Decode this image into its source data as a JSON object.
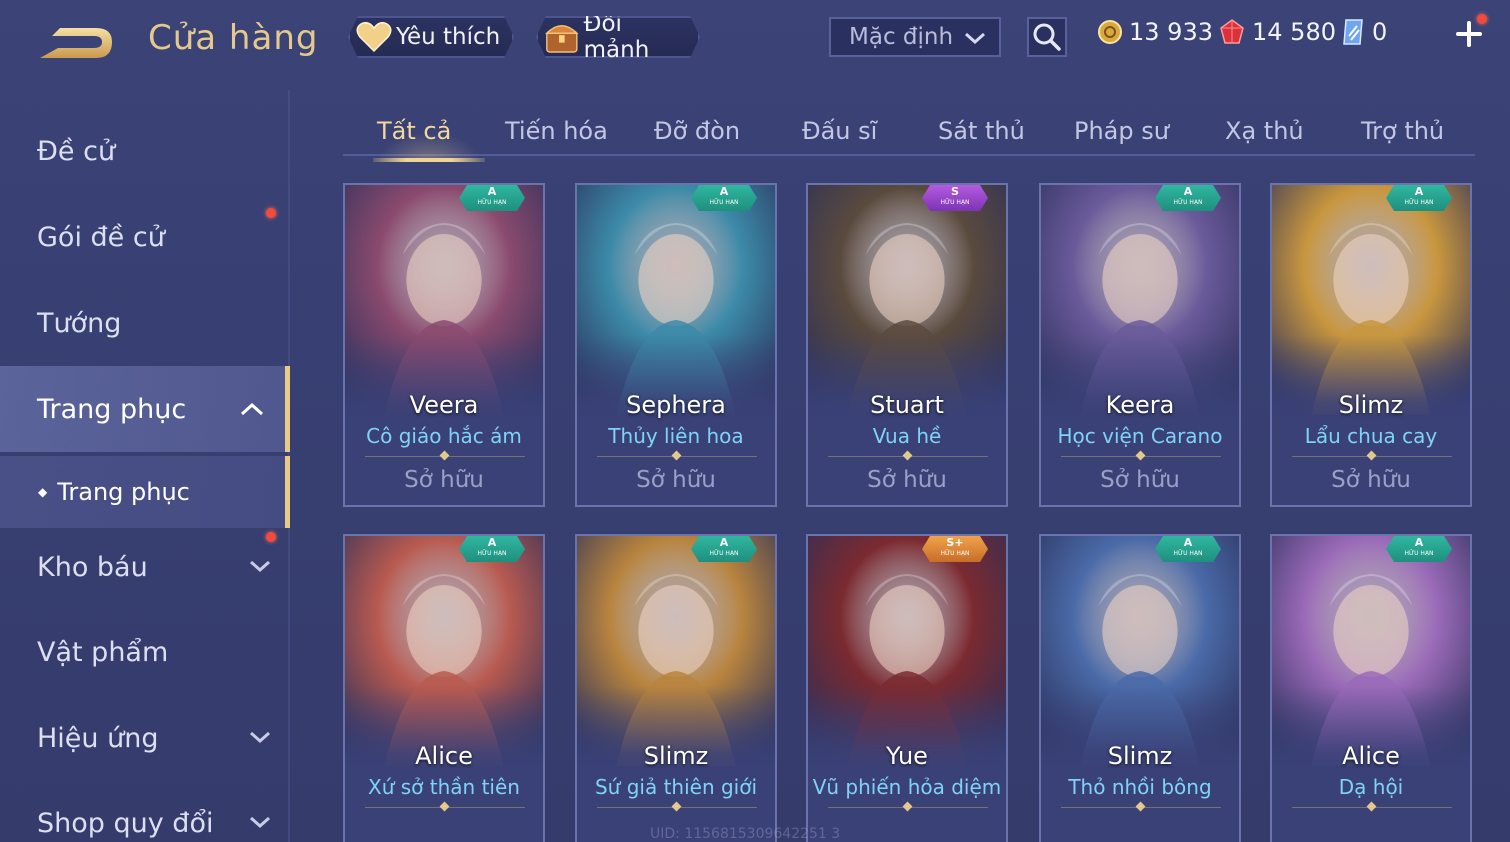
{
  "header": {
    "title": "Cửa hàng",
    "favorite_label": "Yêu thích",
    "exchange_label": "Đổi mảnh",
    "sort_value": "Mặc định"
  },
  "currencies": {
    "gold": "13 933",
    "vouchers": "14 580",
    "diamonds": "0"
  },
  "sidebar": {
    "items": [
      {
        "label": "Đề cử"
      },
      {
        "label": "Gói đề cử"
      },
      {
        "label": "Tướng"
      },
      {
        "label": "Trang phục"
      },
      {
        "label": "Trang phục"
      },
      {
        "label": "Kho báu"
      },
      {
        "label": "Vật phẩm"
      },
      {
        "label": "Hiệu ứng"
      },
      {
        "label": "Shop quy đổi"
      }
    ]
  },
  "tabs": [
    {
      "label": "Tất cả"
    },
    {
      "label": "Tiến hóa"
    },
    {
      "label": "Đỡ đòn"
    },
    {
      "label": "Đấu sĩ"
    },
    {
      "label": "Sát thủ"
    },
    {
      "label": "Pháp sư"
    },
    {
      "label": "Xạ thủ"
    },
    {
      "label": "Trợ thủ"
    }
  ],
  "cards": [
    {
      "hero": "Veera",
      "skin": "Cô giáo hắc ám",
      "status": "Sở hữu",
      "rank": "A",
      "tag": "HỮU HẠN",
      "color": "#8a4a6e"
    },
    {
      "hero": "Sephera",
      "skin": "Thủy liên hoa",
      "status": "Sở hữu",
      "rank": "A",
      "tag": "HỮU HẠN",
      "color": "#3c8aa8"
    },
    {
      "hero": "Stuart",
      "skin": "Vua hề",
      "status": "Sở hữu",
      "rank": "S",
      "tag": "HỮU HẠN",
      "color": "#5a4a3e"
    },
    {
      "hero": "Keera",
      "skin": "Học viện Carano",
      "status": "Sở hữu",
      "rank": "A",
      "tag": "HỮU HẠN",
      "color": "#6a5a9a"
    },
    {
      "hero": "Slimz",
      "skin": "Lẩu chua cay",
      "status": "Sở hữu",
      "rank": "A",
      "tag": "HỮU HẠN",
      "color": "#c8963e"
    },
    {
      "hero": "Alice",
      "skin": "Xứ sở thần tiên",
      "status": "",
      "rank": "A",
      "tag": "HỮU HẠN",
      "color": "#b85a50"
    },
    {
      "hero": "Slimz",
      "skin": "Sứ giả thiên giới",
      "status": "",
      "rank": "A",
      "tag": "HỮU HẠN",
      "color": "#b8843e"
    },
    {
      "hero": "Yue",
      "skin": "Vũ phiến hỏa diệm",
      "status": "",
      "rank": "S+",
      "tag": "HỮU HẠN",
      "color": "#7a2a30"
    },
    {
      "hero": "Slimz",
      "skin": "Thỏ nhồi bông",
      "status": "",
      "rank": "A",
      "tag": "HỮU HẠN",
      "color": "#4a6aa8"
    },
    {
      "hero": "Alice",
      "skin": "Dạ hội",
      "status": "",
      "rank": "A",
      "tag": "HỮU HẠN",
      "color": "#9a6ab8"
    }
  ],
  "footer": {
    "uid": "UID: 1156815309642251 3"
  },
  "colors": {
    "accent_gold": "#e5c98c",
    "skin_blue": "#7fd3f5",
    "badge_teal": "#2fb7a0",
    "notification_red": "#f24a3b"
  }
}
